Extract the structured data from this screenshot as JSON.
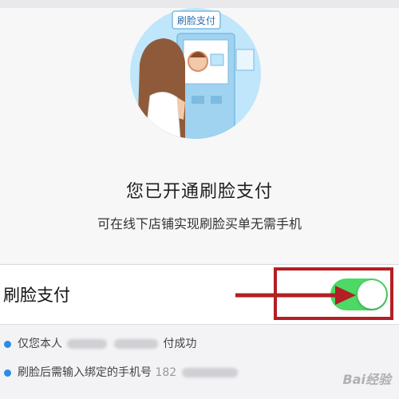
{
  "hero": {
    "badge": "刷脸支付",
    "title": "您已开通刷脸支付",
    "subtitle": "可在线下店铺实现刷脸买单无需手机"
  },
  "setting": {
    "label": "刷脸支付",
    "toggle_on": true,
    "toggle_color": "#4cd964"
  },
  "notes": [
    {
      "prefix": "仅您本人",
      "suffix": "付成功"
    },
    {
      "prefix": "刷脸后需输入绑定的手机号",
      "suffix": "182"
    }
  ],
  "annotation": {
    "color": "#b21f24"
  },
  "watermark": {
    "text": "Bai经验"
  }
}
